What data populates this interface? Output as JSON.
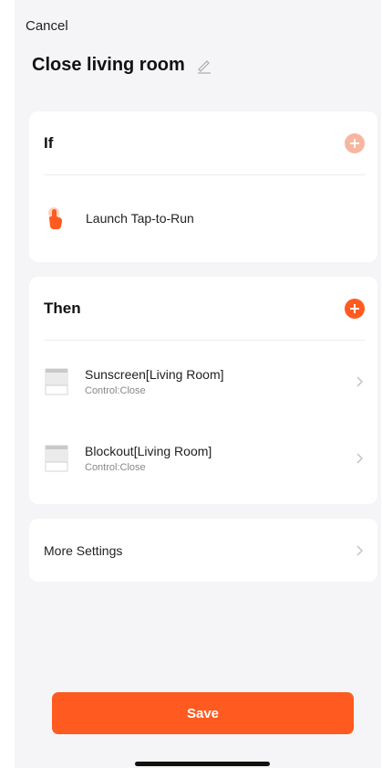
{
  "header": {
    "cancel_label": "Cancel",
    "scene_title": "Close living room"
  },
  "if_section": {
    "label": "If",
    "condition": {
      "text": "Launch Tap-to-Run",
      "icon": "tap-hand-icon"
    }
  },
  "then_section": {
    "label": "Then",
    "actions": [
      {
        "name": "Sunscreen[Living Room]",
        "detail": "Control:Close",
        "icon": "curtain-icon"
      },
      {
        "name": "Blockout[Living Room]",
        "detail": "Control:Close",
        "icon": "curtain-icon"
      }
    ]
  },
  "more_settings": {
    "label": "More Settings"
  },
  "footer": {
    "save_label": "Save"
  },
  "colors": {
    "accent": "#ff5a1f",
    "accent_faded": "#f7b6a0",
    "background": "#f5f5f7",
    "card": "#ffffff"
  }
}
